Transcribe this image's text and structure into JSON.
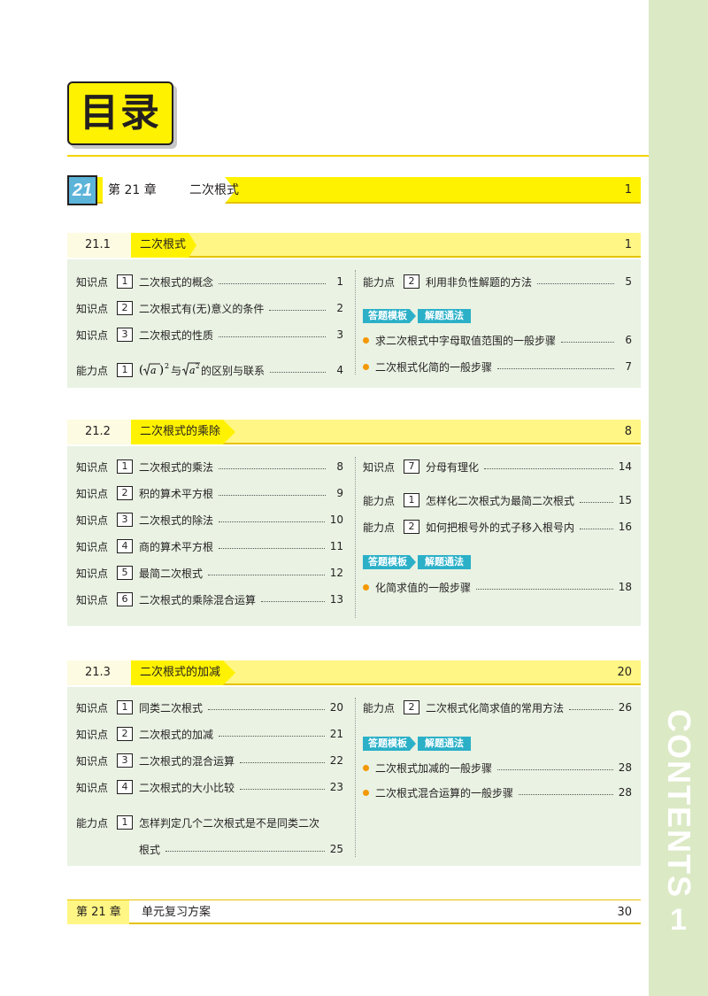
{
  "title": "目录",
  "side": {
    "text": "CONTENTS",
    "page_number": "1"
  },
  "chapter": {
    "badge": "21",
    "label": "第 21 章",
    "name": "二次根式",
    "page": "1"
  },
  "sections": [
    {
      "num": "21.1",
      "title": "二次根式",
      "page": "1",
      "left": [
        {
          "kind": "知识点",
          "n": "1",
          "text": "二次根式的概念",
          "page": "1"
        },
        {
          "kind": "知识点",
          "n": "2",
          "text": "二次根式有(无)意义的条件",
          "page": "2"
        },
        {
          "kind": "知识点",
          "n": "3",
          "text": "二次根式的性质",
          "page": "3"
        },
        {
          "kind": "能力点",
          "n": "1",
          "text": "与",
          "text2": "的区别与联系",
          "page": "4"
        }
      ],
      "right_first": {
        "kind": "能力点",
        "n": "2",
        "text": "利用非负性解题的方法",
        "page": "5"
      },
      "template": {
        "a": "答题模板",
        "b": "解题通法"
      },
      "bullets": [
        {
          "text": "求二次根式中字母取值范围的一般步骤",
          "page": "6"
        },
        {
          "text": "二次根式化简的一般步骤",
          "page": "7"
        }
      ]
    },
    {
      "num": "21.2",
      "title": "二次根式的乘除",
      "page": "8",
      "left": [
        {
          "kind": "知识点",
          "n": "1",
          "text": "二次根式的乘法",
          "page": "8"
        },
        {
          "kind": "知识点",
          "n": "2",
          "text": "积的算术平方根",
          "page": "9"
        },
        {
          "kind": "知识点",
          "n": "3",
          "text": "二次根式的除法",
          "page": "10"
        },
        {
          "kind": "知识点",
          "n": "4",
          "text": "商的算术平方根",
          "page": "11"
        },
        {
          "kind": "知识点",
          "n": "5",
          "text": "最简二次根式",
          "page": "12"
        },
        {
          "kind": "知识点",
          "n": "6",
          "text": "二次根式的乘除混合运算",
          "page": "13"
        }
      ],
      "right": [
        {
          "kind": "知识点",
          "n": "7",
          "text": "分母有理化",
          "page": "14"
        },
        {
          "kind": "能力点",
          "n": "1",
          "text": "怎样化二次根式为最简二次根式",
          "page": "15"
        },
        {
          "kind": "能力点",
          "n": "2",
          "text": "如何把根号外的式子移入根号内",
          "page": "16"
        }
      ],
      "template": {
        "a": "答题模板",
        "b": "解题通法"
      },
      "bullets": [
        {
          "text": "化简求值的一般步骤",
          "page": "18"
        }
      ]
    },
    {
      "num": "21.3",
      "title": "二次根式的加减",
      "page": "20",
      "left": [
        {
          "kind": "知识点",
          "n": "1",
          "text": "同类二次根式",
          "page": "20"
        },
        {
          "kind": "知识点",
          "n": "2",
          "text": "二次根式的加减",
          "page": "21"
        },
        {
          "kind": "知识点",
          "n": "3",
          "text": "二次根式的混合运算",
          "page": "22"
        },
        {
          "kind": "知识点",
          "n": "4",
          "text": "二次根式的大小比较",
          "page": "23"
        },
        {
          "kind": "能力点",
          "n": "1",
          "text": "怎样判定几个二次根式是不是同类二次",
          "cont": "根式",
          "page": "25"
        }
      ],
      "right_first": {
        "kind": "能力点",
        "n": "2",
        "text": "二次根式化简求值的常用方法",
        "page": "26"
      },
      "template": {
        "a": "答题模板",
        "b": "解题通法"
      },
      "bullets": [
        {
          "text": "二次根式加减的一般步骤",
          "page": "28"
        },
        {
          "text": "二次根式混合运算的一般步骤",
          "page": "28"
        }
      ]
    }
  ],
  "unit_review": {
    "label": "第 21 章",
    "name": "单元复习方案",
    "page": "30"
  }
}
